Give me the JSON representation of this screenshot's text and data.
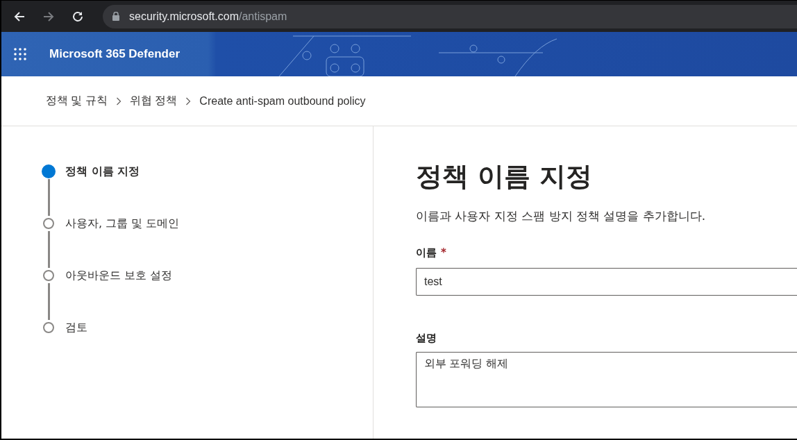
{
  "browser": {
    "url": {
      "host": "security.microsoft.com",
      "path": "/antispam"
    }
  },
  "header": {
    "title": "Microsoft 365 Defender"
  },
  "breadcrumb": [
    "정책 및 규칙",
    "위협 정책",
    "Create anti-spam outbound policy"
  ],
  "steps": [
    {
      "label": "정책 이름 지정",
      "current": true
    },
    {
      "label": "사용자, 그룹 및 도메인",
      "current": false
    },
    {
      "label": "아웃바운드 보호 설정",
      "current": false
    },
    {
      "label": "검토",
      "current": false
    }
  ],
  "content": {
    "title": "정책 이름 지정",
    "description": "이름과 사용자 지정 스팸 방지 정책 설명을 추가합니다.",
    "fields": [
      {
        "kind": "input",
        "label": "이름",
        "required_mark": "*",
        "value": "test"
      },
      {
        "kind": "textarea",
        "label": "설명",
        "value": "외부 포워딩 해제"
      }
    ]
  }
}
